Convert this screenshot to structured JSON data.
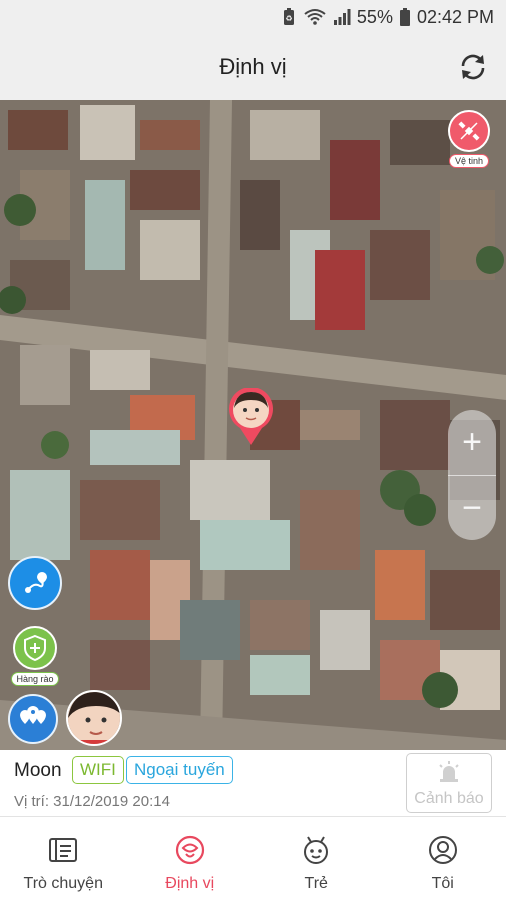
{
  "status_bar": {
    "battery": "55%",
    "time": "02:42 PM"
  },
  "header": {
    "title": "Định vị"
  },
  "map": {
    "satellite_label": "Vệ tinh",
    "zoom_in": "+",
    "zoom_out": "−",
    "fence_label": "Hàng rào"
  },
  "info": {
    "name": "Moon",
    "wifi_badge": "WIFI",
    "status_badge": "Ngoại tuyến",
    "location_time": "Vị trí: 31/12/2019 20:14",
    "alarm_label": "Cảnh báo"
  },
  "nav": {
    "items": [
      {
        "label": "Trò chuyện",
        "icon": "chat-icon"
      },
      {
        "label": "Định vị",
        "icon": "location-icon"
      },
      {
        "label": "Trẻ",
        "icon": "child-icon"
      },
      {
        "label": "Tôi",
        "icon": "profile-icon"
      }
    ]
  },
  "colors": {
    "accent": "#e8485e",
    "wifi_green": "#8cc63f",
    "offline_blue": "#3bb3e6",
    "route_blue": "#1d8ee6"
  }
}
